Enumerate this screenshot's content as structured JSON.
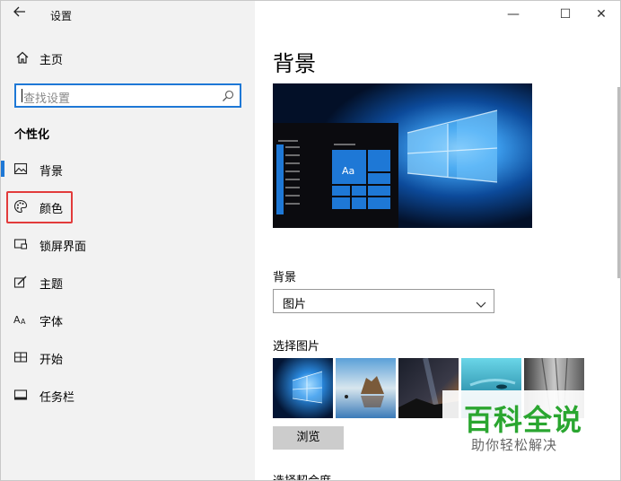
{
  "window": {
    "title": "设置",
    "controls": {
      "minimize": "—",
      "maximize": "☐",
      "close": "✕"
    },
    "back_icon": "back-arrow-icon"
  },
  "sidebar": {
    "home": {
      "label": "主页",
      "icon": "home-icon"
    },
    "search": {
      "placeholder": "查找设置",
      "icon": "search-icon"
    },
    "section_title": "个性化",
    "items": [
      {
        "label": "背景",
        "icon": "picture-icon",
        "active": true
      },
      {
        "label": "颜色",
        "icon": "palette-icon",
        "highlighted": true
      },
      {
        "label": "锁屏界面",
        "icon": "lock-screen-icon"
      },
      {
        "label": "主题",
        "icon": "theme-brush-icon"
      },
      {
        "label": "字体",
        "icon": "font-icon"
      },
      {
        "label": "开始",
        "icon": "start-menu-icon"
      },
      {
        "label": "任务栏",
        "icon": "taskbar-icon"
      }
    ]
  },
  "main": {
    "title": "背景",
    "preview": {
      "tile_label": "Aa"
    },
    "background_label": "背景",
    "background_select": "图片",
    "choose_picture_label": "选择图片",
    "browse_button": "浏览",
    "choose_fit_label": "选择契合度"
  },
  "watermark": {
    "title": "百科全说",
    "subtitle": "助你轻松解决"
  },
  "colors": {
    "accent": "#1e78d6",
    "highlight_box": "#e23b3b",
    "sidebar_bg": "#f2f2f2",
    "watermark_green": "#2aa630"
  }
}
